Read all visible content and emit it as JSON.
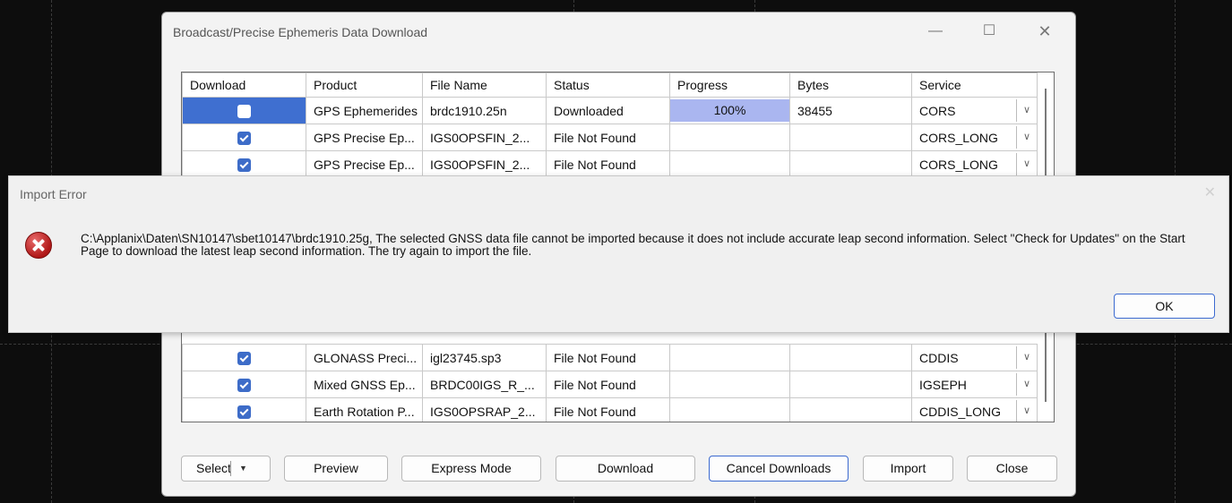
{
  "window": {
    "title": "Broadcast/Precise Ephemeris Data Download",
    "min_glyph": "—",
    "max_glyph": "☐",
    "close_glyph": "✕"
  },
  "table": {
    "headers": [
      "Download",
      "Product",
      "File Name",
      "Status",
      "Progress",
      "Bytes",
      "Service"
    ],
    "top_rows": [
      {
        "checked": false,
        "product": "GPS Ephemerides",
        "file": "brdc1910.25n",
        "status": "Downloaded",
        "progress": "100%",
        "progress_fraction": 1.0,
        "bytes": "38455",
        "service": "CORS"
      },
      {
        "checked": true,
        "product": "GPS Precise Ep...",
        "file": "IGS0OPSFIN_2...",
        "status": "File Not Found",
        "progress": "",
        "bytes": "",
        "service": "CORS_LONG"
      },
      {
        "checked": true,
        "product": "GPS Precise Ep...",
        "file": "IGS0OPSFIN_2...",
        "status": "File Not Found",
        "progress": "",
        "bytes": "",
        "service": "CORS_LONG"
      }
    ],
    "bottom_rows": [
      {
        "checked": true,
        "product": "GLONASS Preci...",
        "file": "igl23745.sp3",
        "status": "File Not Found",
        "progress": "",
        "bytes": "",
        "service": "CDDIS"
      },
      {
        "checked": true,
        "product": "Mixed GNSS Ep...",
        "file": "BRDC00IGS_R_...",
        "status": "File Not Found",
        "progress": "",
        "bytes": "",
        "service": "IGSEPH"
      },
      {
        "checked": true,
        "product": "Earth Rotation P...",
        "file": "IGS0OPSRAP_2...",
        "status": "File Not Found",
        "progress": "",
        "bytes": "",
        "service": "CDDIS_LONG"
      }
    ]
  },
  "buttons": {
    "select": "Select",
    "select_caret": "▼",
    "preview": "Preview",
    "express": "Express Mode",
    "download": "Download",
    "cancel_downloads": "Cancel Downloads",
    "import": "Import",
    "close": "Close"
  },
  "error_dialog": {
    "title": "Import Error",
    "close_glyph": "✕",
    "message": "C:\\Applanix\\Daten\\SN10147\\sbet10147\\brdc1910.25g, The selected GNSS data file cannot be imported because it does not include accurate leap second information. Select \"Check for Updates\" on the Start Page to download the latest leap second information. The try again to import the file.",
    "ok": "OK"
  },
  "colors": {
    "status_ok": "#4aa07a",
    "status_error": "#c4232a",
    "bytes": "#2a36c8",
    "selection": "#3f6fd0",
    "progress_fill": "#aab6f0"
  }
}
